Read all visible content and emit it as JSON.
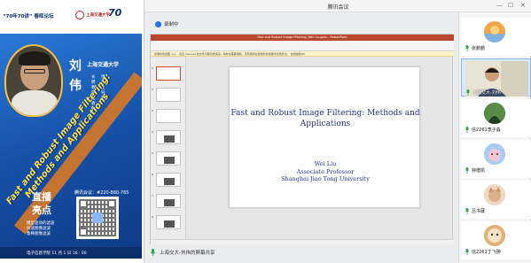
{
  "poster": {
    "tag": "“70年70讲” 春晖论坛",
    "university_logo": "上海交通大学",
    "anniversary": "70",
    "anniversary_sub": "70周年",
    "speaker_name": "刘伟",
    "affiliation": "上海交通大学",
    "title_line1": "长聘教轨副教授",
    "title_line2": "博士生导师",
    "talk_title": "Fast and Robust Image Filtering: Methods and Applications",
    "live_label": "直播",
    "highlight_label": "亮点",
    "meeting_room": "腾讯会议：#220-880-765",
    "highlights": [
      "模型驱动的滤波",
      "快速图像滤波",
      "鲁棒图像滤波"
    ],
    "footer": "电子信息学院   11 月 1 日   16 : 00"
  },
  "window": {
    "title": "腾讯会议",
    "recording_label": "录制中",
    "controls": [
      "—",
      "☐",
      "✕"
    ]
  },
  "ppt": {
    "title_bar": "Fast and Robust Image Filtering_Wei Liu.pptx - PowerPoint",
    "notice": "受保护的视图  小心 - 来自 Internet 的文件可能包含病毒。除非您需要编辑，否则保持在受保护的视图中比较安全。  启用编辑(E)",
    "thumb_numbers": [
      "1",
      "2",
      "3",
      "4",
      "5",
      "6",
      "7",
      "8"
    ],
    "slide_title": "Fast and Robust Image Filtering: Methods and Applications",
    "slide_author": "Wei Liu",
    "slide_position": "Associate Professor",
    "slide_affiliation": "Shanghai Jiao Tong University"
  },
  "share_bar": {
    "label": "上海交大-刘伟的屏幕共享"
  },
  "participants": [
    {
      "name": "张鹏鹏",
      "type": "avatar",
      "color": "#f2a64b"
    },
    {
      "name": "上海交大-刘伟",
      "type": "video",
      "active": true
    },
    {
      "name": "信2261李子淼",
      "type": "avatar",
      "color": "#3b6e3b"
    },
    {
      "name": "钟楷凯",
      "type": "avatar",
      "color": "#8bb9e8"
    },
    {
      "name": "吕书葳",
      "type": "avatar",
      "color": "#e8c9a9"
    },
    {
      "name": "信2261丁飞翀",
      "type": "avatar",
      "color": "#d7a56a"
    }
  ],
  "colors": {
    "accent": "#1b73e8",
    "poster_blue": "#1c5fb8",
    "slide_text": "#2e3192",
    "ppt_brand": "#b7472a"
  }
}
